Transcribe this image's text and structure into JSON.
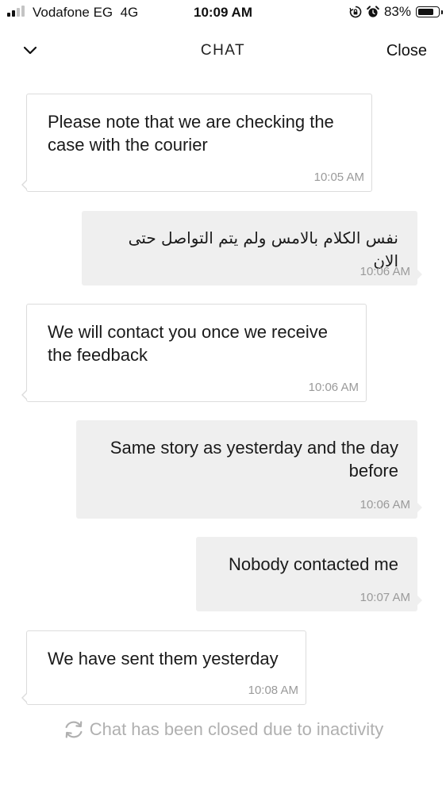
{
  "status_bar": {
    "carrier": "Vodafone EG",
    "network": "4G",
    "time": "10:09 AM",
    "battery_percent": "83%",
    "battery_level": 0.83,
    "signal_bars_active": 2,
    "signal_bars_total": 4,
    "icons": [
      "signal-icon",
      "orientation-lock-icon",
      "alarm-icon",
      "battery-icon"
    ]
  },
  "header": {
    "back_icon": "chevron-down-icon",
    "title": "CHAT",
    "close_label": "Close"
  },
  "messages": [
    {
      "direction": "incoming",
      "text": "Please note that we are checking the case with the courier",
      "time": "10:05 AM"
    },
    {
      "direction": "outgoing",
      "text": "نفس الكلام بالامس ولم يتم التواصل حتى الان",
      "time": "10:06 AM"
    },
    {
      "direction": "incoming",
      "text": "We will contact you once we receive the feedback",
      "time": "10:06 AM"
    },
    {
      "direction": "outgoing",
      "text": "Same story as yesterday and the day before",
      "time": "10:06 AM"
    },
    {
      "direction": "outgoing",
      "text": "Nobody contacted me",
      "time": "10:07 AM"
    },
    {
      "direction": "incoming",
      "text": "We have sent them yesterday",
      "time": "10:08 AM"
    }
  ],
  "system_notice": {
    "icon": "refresh-icon",
    "text": "Chat has been closed due to inactivity"
  },
  "colors": {
    "text_primary": "#1a1a1a",
    "timestamp": "#9a9a9a",
    "incoming_bubble": "#ffffff",
    "incoming_border": "#dcdcdc",
    "outgoing_bubble": "#efefef",
    "system_notice": "#b0b0b0",
    "signal_active": "#111111",
    "signal_inactive": "#c4c4c4",
    "battery_fill": "#111111"
  }
}
